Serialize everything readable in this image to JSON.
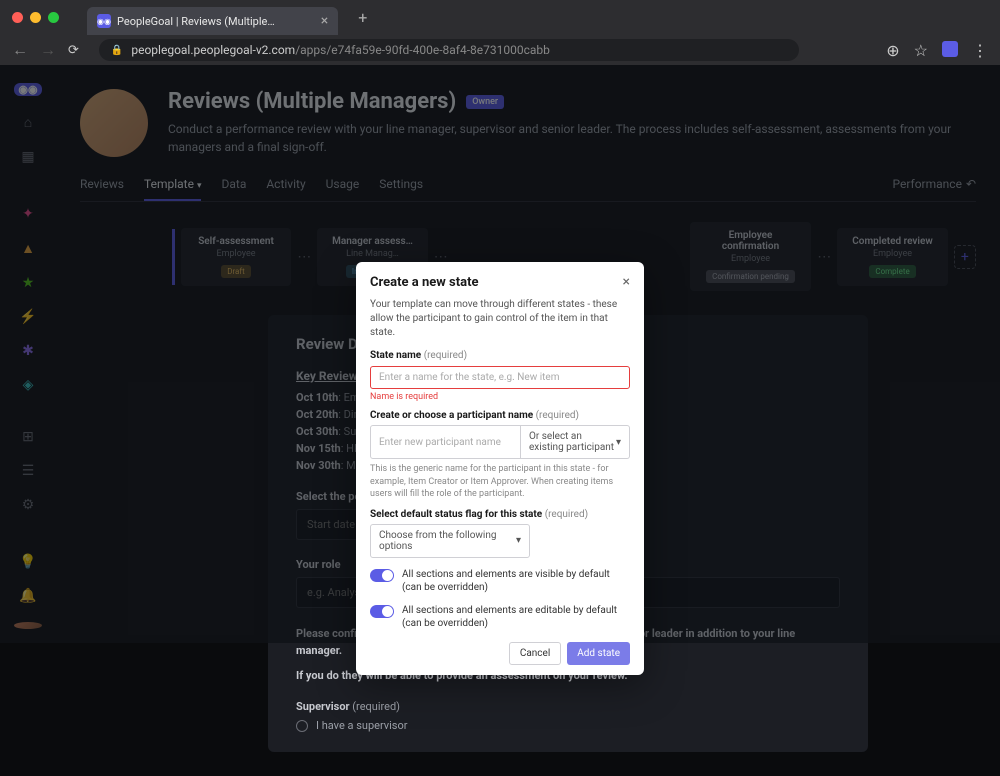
{
  "browser": {
    "tab_title": "PeopleGoal | Reviews (Multiple…",
    "url_host": "peoplegoal.peoplegoal-v2.com",
    "url_path": "/apps/e74fa59e-90fd-400e-8af4-8e731000cabb"
  },
  "header": {
    "title": "Reviews (Multiple Managers)",
    "badge": "Owner",
    "desc": "Conduct a performance review with your line manager, supervisor and senior leader. The process includes self-assessment, assessments from your managers and a final sign-off."
  },
  "tabs": {
    "reviews": "Reviews",
    "template": "Template",
    "data": "Data",
    "activity": "Activity",
    "usage": "Usage",
    "settings": "Settings",
    "performance": "Performance"
  },
  "workflow": [
    {
      "title": "Self-assessment",
      "sub": "Employee",
      "badge": "Draft",
      "badge_cls": "draft"
    },
    {
      "title": "Manager assess…",
      "sub": "Line Manag…",
      "badge": "In progres…",
      "badge_cls": "progress"
    },
    {
      "title": "Employee confirmation",
      "sub": "Employee",
      "badge": "Confirmation pending",
      "badge_cls": "pending"
    },
    {
      "title": "Completed review",
      "sub": "Employee",
      "badge": "Complete",
      "badge_cls": "complete"
    }
  ],
  "details": {
    "title": "Review Detai…",
    "kd_title": "Key Review Dat…",
    "kd1_b": "Oct 10th",
    "kd1_t": ": Employe…",
    "kd2_b": "Oct 20th",
    "kd2_t": ": Direct M…",
    "kd3_b": "Oct 30th",
    "kd3_t": ": Supervis…",
    "kd4_b": "Nov 15th",
    "kd4_t": ": HR and F…",
    "kd5_b": "Nov 30th",
    "kd5_t": ": Manage…",
    "period_label": "Select the period o…",
    "start_date": "Start date",
    "role_label": "Your role",
    "role_ph": "e.g. Analyst, Associate, Manager, Director, MD",
    "confirm1": "Please confirm whether you do or do not have a supervisor and a senior leader in addition to your line manager.",
    "confirm2": "If you do they will be able to provide an assessment on your review.",
    "supervisor_label": "Supervisor",
    "req": "(required)",
    "radio1": "I have a supervisor"
  },
  "modal": {
    "title": "Create a new state",
    "desc": "Your template can move through different states - these allow the participant to gain control of the item in that state.",
    "state_name_label": "State name",
    "req": "(required)",
    "state_name_ph": "Enter a name for the state, e.g. New item",
    "error": "Name is required",
    "participant_label": "Create or choose a participant name",
    "participant_ph": "Enter new participant name",
    "participant_sel": "Or select an existing participant",
    "participant_hint": "This is the generic name for the participant in this state - for example, Item Creator or Item Approver. When creating items users will fill the role of the participant.",
    "status_label": "Select default status flag for this state",
    "status_sel": "Choose from the following options",
    "toggle1": "All sections and elements are visible by default (can be overridden)",
    "toggle2": "All sections and elements are editable by default (can be overridden)",
    "cancel": "Cancel",
    "add": "Add state"
  }
}
